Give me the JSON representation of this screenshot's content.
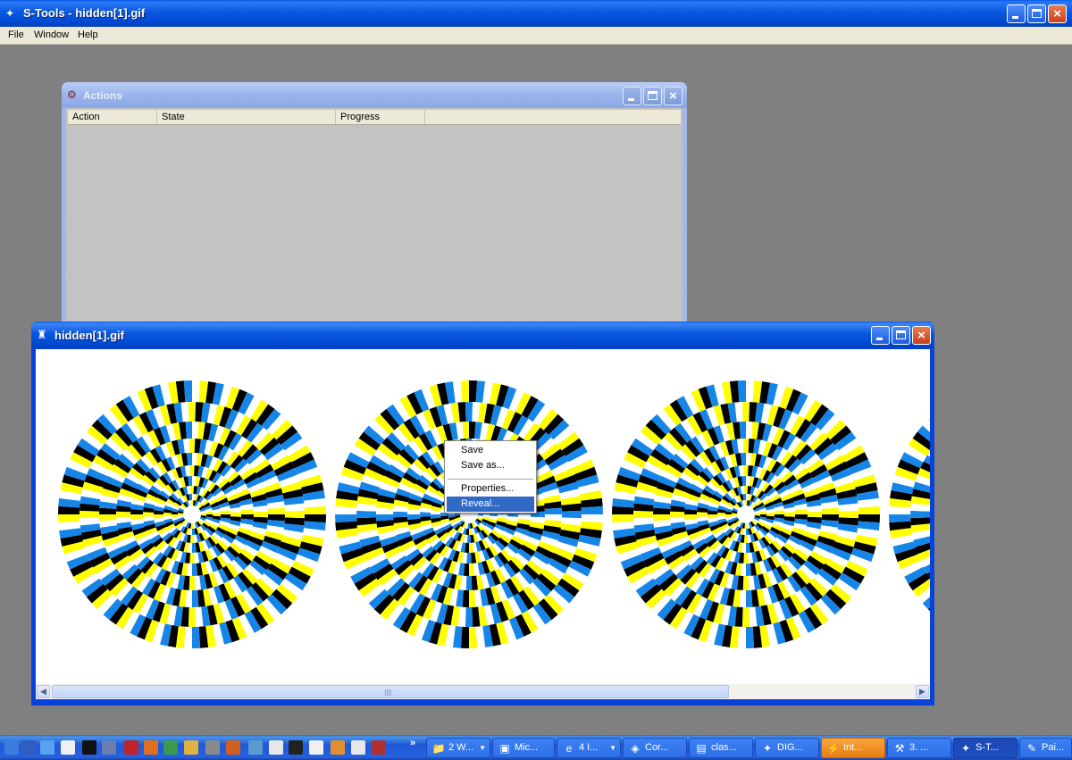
{
  "app": {
    "title": "S-Tools - hidden[1].gif",
    "title_icon": "stools-app-icon"
  },
  "menubar": {
    "items": [
      "File",
      "Window",
      "Help"
    ]
  },
  "actions_window": {
    "title": "Actions",
    "columns": [
      "Action",
      "State",
      "Progress"
    ],
    "rows": []
  },
  "image_window": {
    "title": "hidden[1].gif",
    "content": "rotating-snakes-illusion-image",
    "colors": {
      "blue": "#1585e8",
      "yellow": "#ffff00",
      "black": "#000000",
      "white": "#ffffff"
    }
  },
  "context_menu": {
    "items": [
      "Save",
      "Save as...",
      "Properties...",
      "Reveal..."
    ],
    "selected": "Reveal..."
  },
  "taskbar": {
    "quick_launch": [
      "show-desktop-icon",
      "network-icon",
      "app-icon",
      "notepad-icon",
      "cmd-icon",
      "document-icon",
      "acrobat-icon",
      "firefox-icon",
      "paint-icon",
      "folder-icon",
      "tool-icon",
      "hammer-icon",
      "map-icon",
      "window-icon",
      "terminal-icon",
      "compass-icon",
      "brush-icon",
      "browser-window-icon",
      "bug-icon"
    ],
    "buttons": [
      {
        "label": "2 W...",
        "icon": "folder-icon",
        "grouped": true
      },
      {
        "label": "Mic...",
        "icon": "app-window-icon",
        "grouped": false
      },
      {
        "label": "4 I...",
        "icon": "ie-icon",
        "grouped": true
      },
      {
        "label": "Cor...",
        "icon": "corel-icon",
        "grouped": false
      },
      {
        "label": "clas...",
        "icon": "class-icon",
        "grouped": false
      },
      {
        "label": "DIG...",
        "icon": "digital-icon",
        "grouped": false
      },
      {
        "label": "Int...",
        "icon": "flash-icon",
        "grouped": false,
        "state": "flashing"
      },
      {
        "label": "3. ...",
        "icon": "tool-icon",
        "grouped": false
      },
      {
        "label": "S-T...",
        "icon": "stools-icon",
        "grouped": false,
        "state": "active"
      },
      {
        "label": "Pai...",
        "icon": "paint-icon",
        "grouped": false
      }
    ]
  }
}
